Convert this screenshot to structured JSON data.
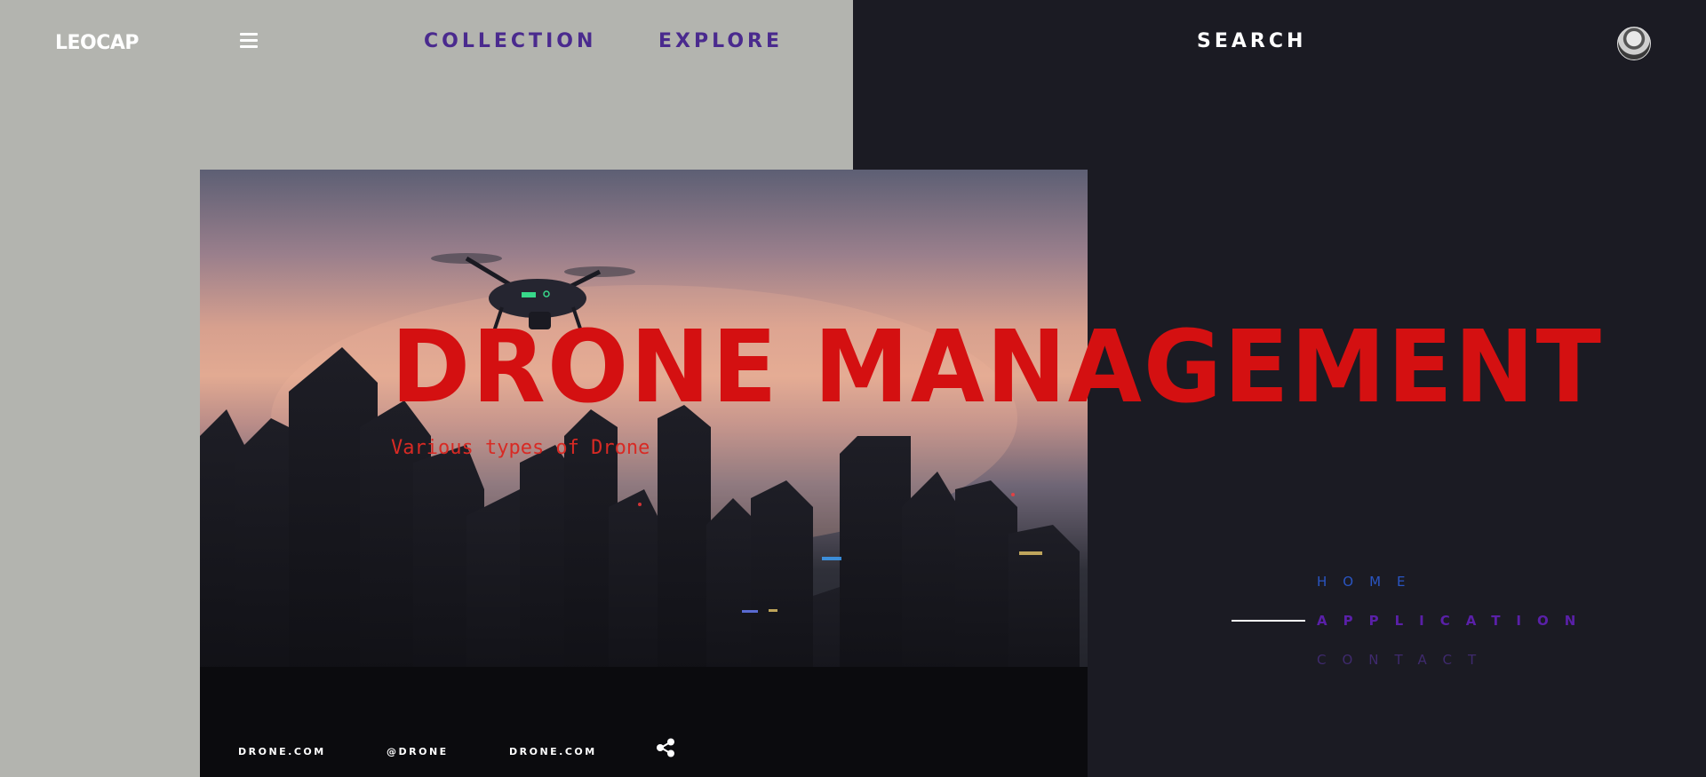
{
  "header": {
    "logo": "LEOCAP",
    "menu_icon": "hamburger-menu-icon",
    "nav": {
      "collection": "COLLECTION",
      "explore": "EXPLORE",
      "search": "SEARCH"
    },
    "avatar_icon": "user-avatar"
  },
  "hero": {
    "title": "DRONE MANAGEMENT",
    "subtitle": "Various types of Drone",
    "footer_links": [
      "DRONE.COM",
      "@DRONE",
      "DRONE.COM"
    ],
    "share_icon": "share-icon"
  },
  "side_nav": {
    "items": [
      "HOME",
      "APPLICATION",
      "CONTACT"
    ],
    "active": "APPLICATION"
  },
  "colors": {
    "left_bg": "#b3b4af",
    "right_bg": "#1b1b23",
    "title_red": "#d41011",
    "nav_purple": "#4a2a8e",
    "home_blue": "#2a55c2",
    "active_purple": "#5a20a8"
  }
}
